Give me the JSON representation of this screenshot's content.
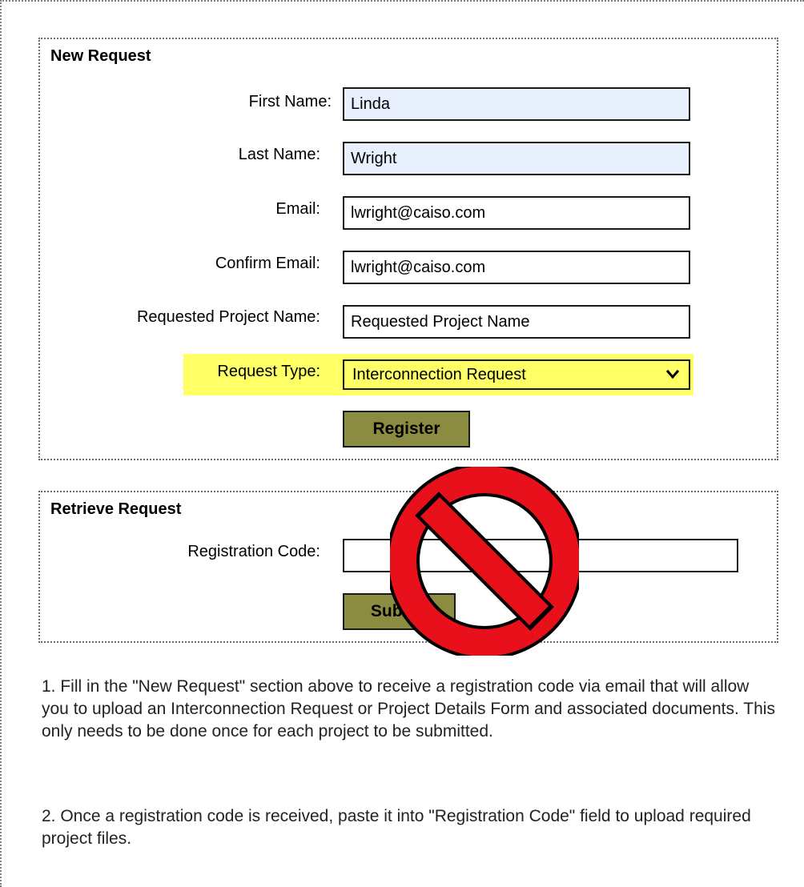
{
  "new_request": {
    "legend": "New Request",
    "first_name_label": "First Name:",
    "first_name_value": "Linda",
    "last_name_label": "Last Name:",
    "last_name_value": "Wright",
    "email_label": "Email:",
    "email_value": "lwright@caiso.com",
    "confirm_email_label": "Confirm Email:",
    "confirm_email_value": "lwright@caiso.com",
    "project_name_label": "Requested Project Name:",
    "project_name_value": "Requested Project Name",
    "request_type_label": "Request Type:",
    "request_type_value": "Interconnection Request",
    "register_label": "Register"
  },
  "retrieve_request": {
    "legend": "Retrieve Request",
    "registration_code_label": "Registration Code:",
    "registration_code_value": "",
    "submit_label": "Submit"
  },
  "instructions": {
    "step1": "1. Fill in the \"New Request\" section above to receive a registration code via email that will allow you to upload an Interconnection Request or Project Details Form and associated documents. This only needs to be done once for each project to be submitted.",
    "step2": "2. Once a registration code is received, paste it into \"Registration Code\" field to upload required project files."
  },
  "overlay": {
    "icon": "prohibited-icon",
    "color": "#e8101a"
  },
  "colors": {
    "button": "#8b8c40",
    "highlight": "#ffff66",
    "autofill": "#e8f0fe"
  }
}
